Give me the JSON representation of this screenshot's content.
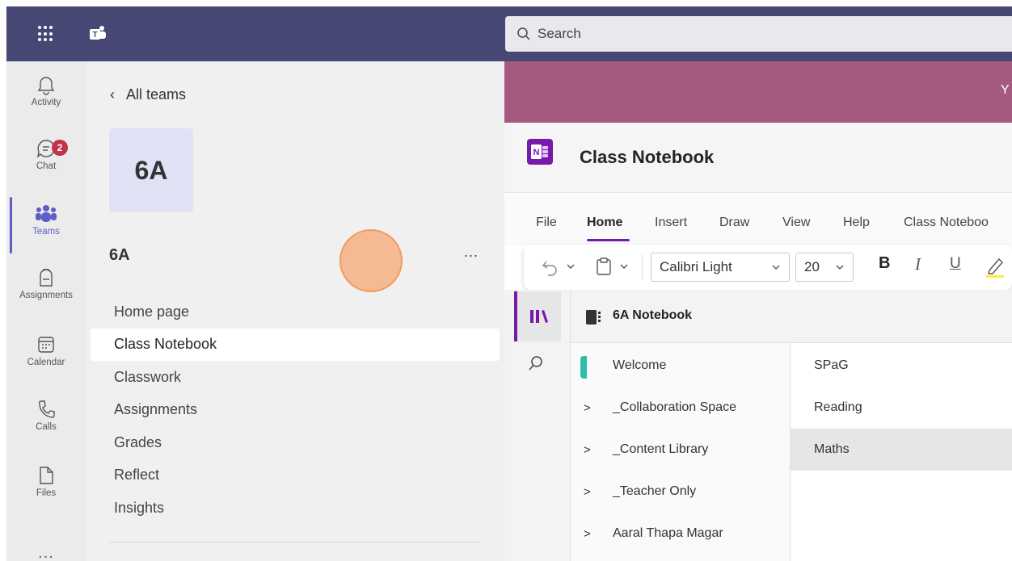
{
  "topbar": {
    "search_placeholder": "Search",
    "accent": "#464775"
  },
  "rail": {
    "items": [
      {
        "label": "Activity",
        "icon": "bell-icon"
      },
      {
        "label": "Chat",
        "icon": "chat-icon",
        "badge": "2"
      },
      {
        "label": "Teams",
        "icon": "teams-icon",
        "active": true
      },
      {
        "label": "Assignments",
        "icon": "backpack-icon"
      },
      {
        "label": "Calendar",
        "icon": "calendar-icon"
      },
      {
        "label": "Calls",
        "icon": "phone-icon"
      },
      {
        "label": "Files",
        "icon": "file-icon"
      }
    ],
    "more": "..."
  },
  "panel": {
    "back_label": "All teams",
    "avatar_text": "6A",
    "team_name": "6A",
    "more": "...",
    "nav": [
      "Home page",
      "Class Notebook",
      "Classwork",
      "Assignments",
      "Grades",
      "Reflect",
      "Insights"
    ],
    "selected_nav": "Class Notebook"
  },
  "main": {
    "banner_text": "Y",
    "banner_color": "#a55a82",
    "notebook_icon_text": "N",
    "title": "Class Notebook",
    "ribbon_tabs": [
      "File",
      "Home",
      "Insert",
      "Draw",
      "View",
      "Help",
      "Class Noteboo"
    ],
    "active_tab": "Home",
    "font_name": "Calibri Light",
    "font_size": "20",
    "format_buttons": {
      "bold": "B",
      "italic": "I",
      "underline": "U"
    },
    "notebook_name": "6A Notebook",
    "sections": [
      "Welcome",
      "_Collaboration Space",
      "_Content Library",
      "_Teacher Only",
      "Aaral Thapa Magar"
    ],
    "pages": [
      "SPaG",
      "Reading",
      "Maths"
    ],
    "selected_page": "Maths",
    "brand_color": "#7719aa"
  }
}
